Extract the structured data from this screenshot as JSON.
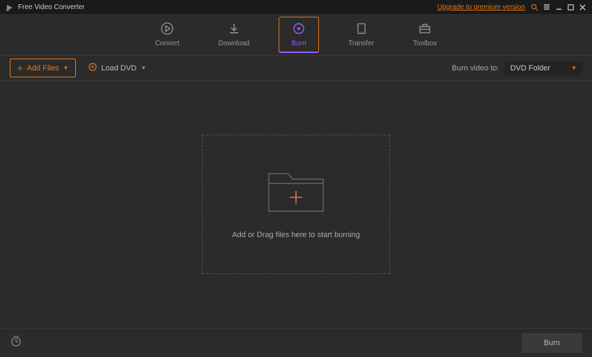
{
  "titlebar": {
    "app_name": "Free Video Converter",
    "upgrade_text": "Upgrade to premium version"
  },
  "tabs": {
    "convert": "Convert",
    "download": "Download",
    "burn": "Burn",
    "transfer": "Transfer",
    "toolbox": "Toolbox",
    "active": "burn"
  },
  "toolbar": {
    "add_files": "Add Files",
    "load_dvd": "Load DVD",
    "burn_to_label": "Burn video to:",
    "burn_to_value": "DVD Folder"
  },
  "dropzone": {
    "text": "Add or Drag files here to start burning"
  },
  "footer": {
    "burn_button": "Burn"
  }
}
